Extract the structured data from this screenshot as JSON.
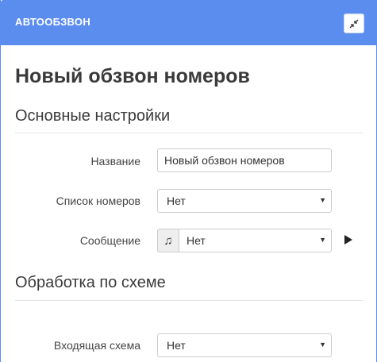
{
  "header": {
    "title": "АВТООБЗВОН",
    "collapse_icon": "collapse-arrows-icon"
  },
  "page": {
    "title": "Новый обзвон номеров"
  },
  "sections": {
    "basic": {
      "title": "Основные настройки",
      "name_label": "Название",
      "name_value": "Новый обзвон номеров",
      "list_label": "Список номеров",
      "list_value": "Нет",
      "message_label": "Сообщение",
      "message_icon": "music-note-icon",
      "message_value": "Нет",
      "play_icon": "play-icon"
    },
    "scheme": {
      "title": "Обработка по схеме",
      "incoming_label": "Входящая схема",
      "incoming_value": "Нет"
    }
  },
  "colors": {
    "header_bg": "#5b8def",
    "header_text": "#ffffff"
  }
}
